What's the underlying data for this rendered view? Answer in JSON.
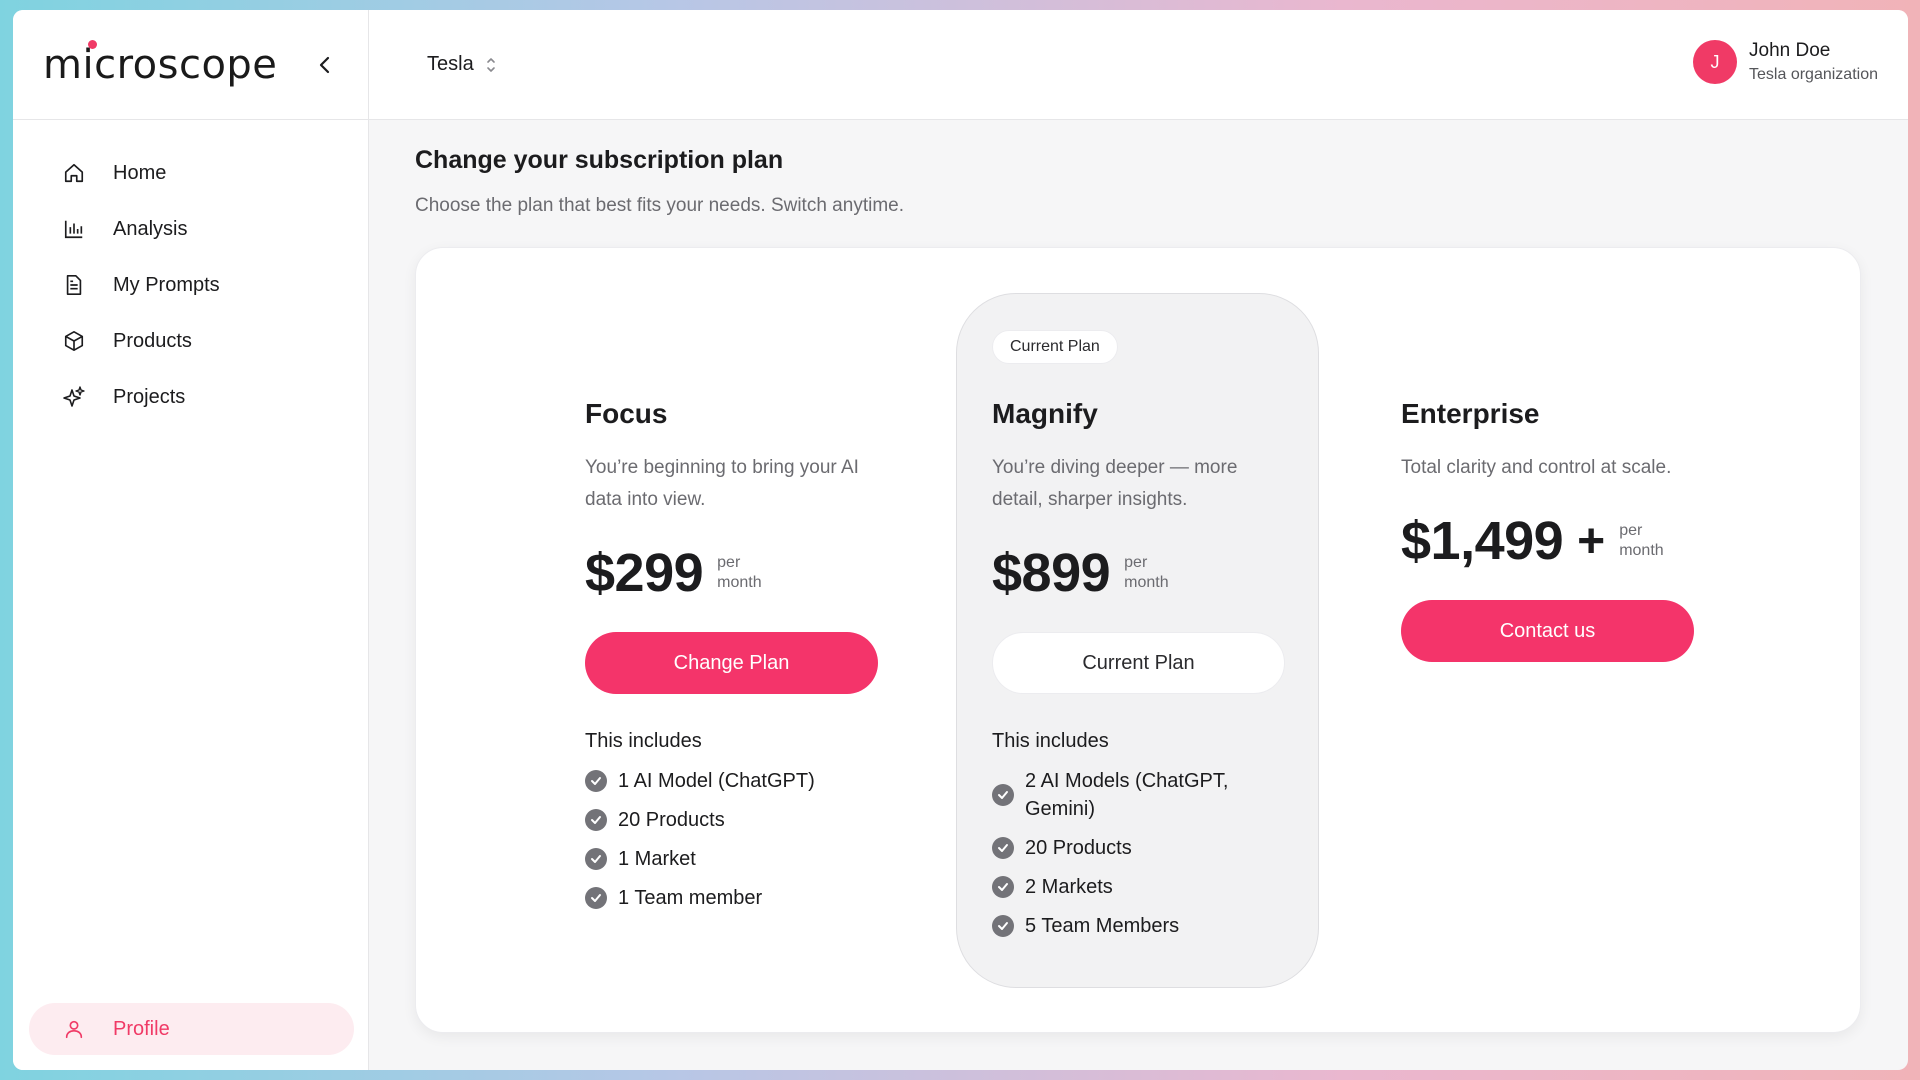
{
  "sidebar": {
    "logo": "microscope",
    "items": [
      {
        "label": "Home",
        "icon": "home-icon"
      },
      {
        "label": "Analysis",
        "icon": "bar-chart-icon"
      },
      {
        "label": "My Prompts",
        "icon": "document-icon"
      },
      {
        "label": "Products",
        "icon": "cube-icon"
      },
      {
        "label": "Projects",
        "icon": "sparkles-icon"
      }
    ],
    "profile": {
      "label": "Profile",
      "icon": "user-icon"
    }
  },
  "topbar": {
    "organization": "Tesla",
    "user": {
      "initial": "J",
      "name": "John Doe",
      "org": "Tesla organization"
    }
  },
  "page": {
    "title": "Change your subscription plan",
    "subtitle": "Choose the plan that best fits your needs. Switch anytime."
  },
  "plans": [
    {
      "name": "Focus",
      "description": "You’re beginning to bring your AI data into view.",
      "price": "$299",
      "per": "per",
      "period": "month",
      "button": "Change Plan",
      "includes_label": "This includes",
      "features": [
        "1 AI Model (ChatGPT)",
        "20 Products",
        "1 Market",
        "1 Team member"
      ]
    },
    {
      "name": "Magnify",
      "badge": "Current Plan",
      "description": "You’re diving deeper — more detail, sharper insights.",
      "price": "$899",
      "per": "per",
      "period": "month",
      "button": "Current Plan",
      "includes_label": "This includes",
      "features": [
        "2 AI Models (ChatGPT, Gemini)",
        "20 Products",
        "2 Markets",
        "5 Team Members"
      ]
    },
    {
      "name": "Enterprise",
      "description": "Total clarity and control at scale.",
      "price": "$1,499",
      "plus": "+",
      "per": "per",
      "period": "month",
      "button": "Contact us"
    }
  ],
  "colors": {
    "accent": "#f4346a",
    "profile_bg": "#fdecf0",
    "check": "#737378"
  }
}
